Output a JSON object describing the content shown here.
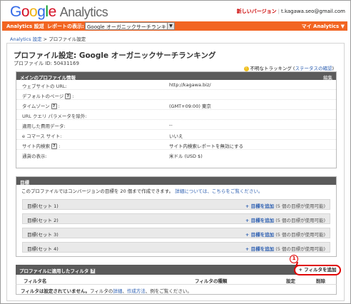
{
  "header": {
    "logo_google": "Google",
    "logo_analytics": "Analytics",
    "new_version": "新しいバージョン",
    "separator": "|",
    "email": "t.kagawa.seo@gmail.com"
  },
  "navbar": {
    "settings": "Analytics 設定",
    "sep": "|",
    "report_label": "レポートの表示:",
    "profile_select": "Google オーガニックサーチランキング",
    "my_analytics": "マイ Analytics ▼"
  },
  "breadcrumb": {
    "root": "Analytics 設定",
    "sep": ">",
    "current": "プロファイル設定"
  },
  "page": {
    "title": "プロファイル設定: Google オーガニックサーチランキング",
    "profile_id": "プロファイル ID: 50431169",
    "tracking_status": "不明なトラッキング",
    "tracking_link": "ステータスの確認",
    "tracking_paren_open": "(",
    "tracking_paren_close": ")"
  },
  "main_info": {
    "header": "メインのプロファイル情報",
    "edit": "編集",
    "rows": [
      {
        "label": "ウェブサイトの URL:",
        "value": "http://kagawa.biz/"
      },
      {
        "label": "デフォルトのページ",
        "value": ""
      },
      {
        "label": "タイムゾーン",
        "value": "(GMT+09:00) 東京"
      },
      {
        "label": "URL クエリ パラメータを除外:",
        "value": ""
      },
      {
        "label": "適用した費用データ:",
        "value": "--"
      },
      {
        "label": "e コマース サイト:",
        "value": "いいえ"
      },
      {
        "label": "サイト内検索",
        "value": "サイト内検索レポートを無効にする"
      },
      {
        "label": "通貨の表示:",
        "value": "米ドル (USD $)"
      }
    ]
  },
  "goals": {
    "header": "目標",
    "description": "このプロファイルではコンバージョンの目標を 20 個まで作成できます。",
    "details_link": "詳細については、こちらをご覧ください。",
    "sets": [
      {
        "label": "目標(セット 1)",
        "add": "+ 目標を追加",
        "note": "(5 個の目標が使用可能)"
      },
      {
        "label": "目標(セット 2)",
        "add": "+ 目標を追加",
        "note": "(5 個の目標が使用可能)"
      },
      {
        "label": "目標(セット 3)",
        "add": "+ 目標を追加",
        "note": "(5 個の目標が使用可能)"
      },
      {
        "label": "目標(セット 4)",
        "add": "+ 目標を追加",
        "note": "(5 個の目標が使用可能)"
      }
    ]
  },
  "filters": {
    "header": "プロファイルに適用したフィルタ",
    "add_button": "+ フィルタを追加",
    "callout": "1",
    "columns": [
      "フィルタ名",
      "フィルタの種類",
      "設定",
      "削除"
    ],
    "none_bold": "フィルタは設定されていません。",
    "none_text": "フィルタの",
    "link_details": "詳細",
    "link_howto": "作成方法",
    "examples": "、例をご覧ください。",
    "punct1": "、"
  },
  "icons": {
    "help": "?",
    "warning": "!"
  },
  "colors": {
    "orange_bar": "#f26522",
    "section_header": "#5b5b5b",
    "link": "#2a5db0",
    "highlight": "#e00000"
  }
}
